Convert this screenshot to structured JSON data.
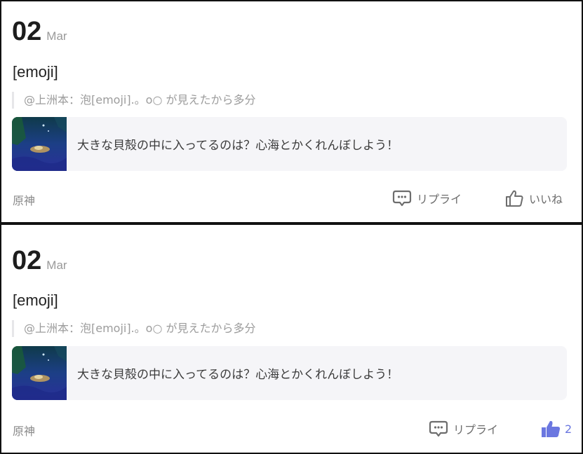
{
  "posts": [
    {
      "day": "02",
      "month": "Mar",
      "content": "[emoji]",
      "quote": "@上洲本：泡[emoji].。o○ が見えたから多分",
      "card_text": "大きな貝殻の中に入ってるのは？心海とかくれんぼしよう！",
      "tag": "原神",
      "reply_label": "リプライ",
      "like_label": "いいね",
      "like_state": "not-liked"
    },
    {
      "day": "02",
      "month": "Mar",
      "content": "[emoji]",
      "quote": "@上洲本：泡[emoji].。o○ が見えたから多分",
      "card_text": "大きな貝殻の中に入ってるのは？心海とかくれんぼしよう！",
      "tag": "原神",
      "reply_label": "リプライ",
      "like_label": "2",
      "like_state": "liked"
    }
  ],
  "colors": {
    "accent": "#6b77e0",
    "card_bg": "#f5f5f8",
    "muted_text": "#9c9c9c"
  },
  "icons": {
    "reply": "speech-bubble-icon",
    "like": "thumbs-up-icon"
  }
}
